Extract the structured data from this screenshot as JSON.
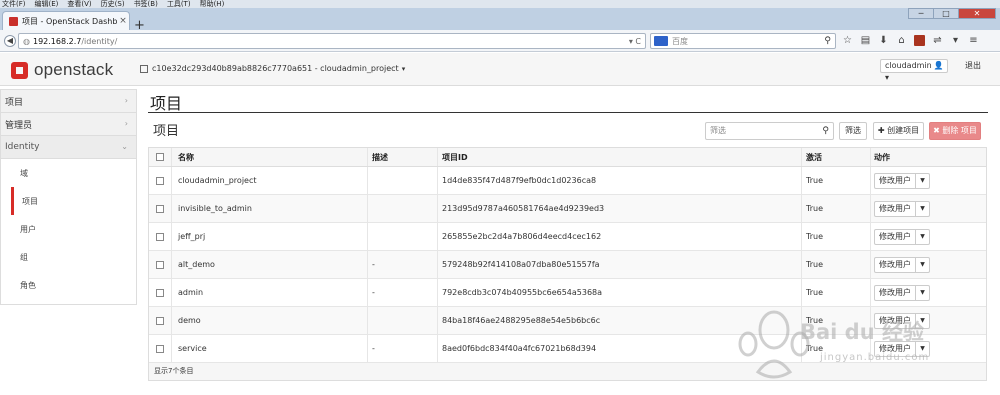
{
  "browser": {
    "menu": [
      "文件(F)",
      "编辑(E)",
      "查看(V)",
      "历史(S)",
      "书签(B)",
      "工具(T)",
      "帮助(H)"
    ],
    "tab_title": "项目 - OpenStack Dashb",
    "tab_close": "×",
    "new_tab": "+",
    "url_host": "192.168.2.7",
    "url_path": "/identity/",
    "url_tools": "▾ C",
    "search_placeholder": "百度",
    "window_controls": [
      "─",
      "□",
      "✕"
    ]
  },
  "header": {
    "logo_text": "openstack",
    "project_selector": "c10e32dc293d40b89ab8826c7770a651 - cloudadmin_project",
    "user": "cloudadmin",
    "logout": "退出"
  },
  "sidebar": {
    "sections": [
      {
        "label": "项目"
      },
      {
        "label": "管理员"
      },
      {
        "label": "Identity"
      }
    ],
    "items": [
      {
        "label": "域"
      },
      {
        "label": "项目"
      },
      {
        "label": "用户"
      },
      {
        "label": "组"
      },
      {
        "label": "角色"
      }
    ]
  },
  "main": {
    "page_title": "项目",
    "section_title": "项目",
    "filter_placeholder": "筛选",
    "filter_button": "筛选",
    "create_button": "创建项目",
    "delete_button": "删除 项目",
    "columns": {
      "name": "名称",
      "description": "描述",
      "project_id": "项目ID",
      "enabled": "激活",
      "actions": "动作"
    },
    "rows": [
      {
        "name": "cloudadmin_project",
        "description": "",
        "id": "1d4de835f47d487f9efb0dc1d0236ca8",
        "enabled": "True",
        "action": "修改用户"
      },
      {
        "name": "invisible_to_admin",
        "description": "",
        "id": "213d95d9787a460581764ae4d9239ed3",
        "enabled": "True",
        "action": "修改用户"
      },
      {
        "name": "jeff_prj",
        "description": "",
        "id": "265855e2bc2d4a7b806d4eecd4cec162",
        "enabled": "True",
        "action": "修改用户"
      },
      {
        "name": "alt_demo",
        "description": "-",
        "id": "579248b92f414108a07dba80e51557fa",
        "enabled": "True",
        "action": "修改用户"
      },
      {
        "name": "admin",
        "description": "-",
        "id": "792e8cdb3c074b40955bc6e654a5368a",
        "enabled": "True",
        "action": "修改用户"
      },
      {
        "name": "demo",
        "description": "",
        "id": "84ba18f46ae2488295e88e54e5b6bc6c",
        "enabled": "True",
        "action": "修改用户"
      },
      {
        "name": "service",
        "description": "-",
        "id": "8aed0f6bdc834f40a4fc67021b68d394",
        "enabled": "True",
        "action": "修改用户"
      }
    ],
    "footer": "显示7个条目"
  },
  "watermark": {
    "text": "Bai du 经验",
    "sub": "jingyan.baidu.com"
  },
  "colors": {
    "brand_red": "#d72c27",
    "delete_button": "#e9898a"
  }
}
